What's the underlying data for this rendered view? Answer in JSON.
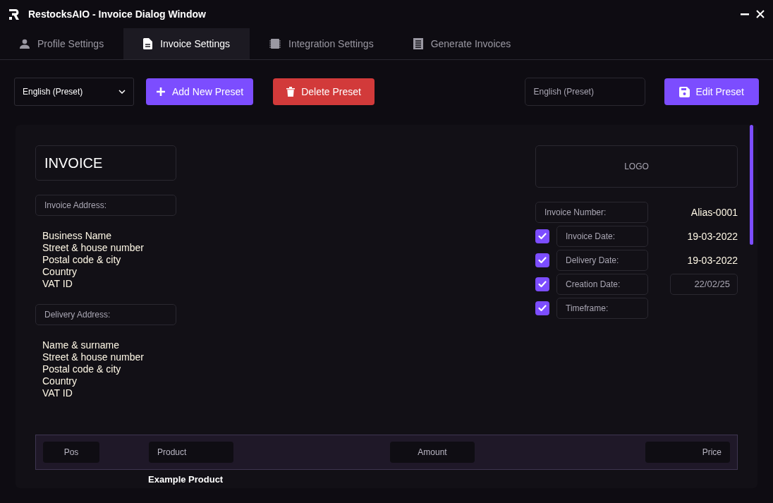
{
  "window": {
    "title": "RestocksAIO - Invoice Dialog Window"
  },
  "tabs": [
    {
      "label": "Profile Settings",
      "selected": false
    },
    {
      "label": "Invoice Settings",
      "selected": true
    },
    {
      "label": "Integration Settings",
      "selected": false
    },
    {
      "label": "Generate Invoices",
      "selected": false
    }
  ],
  "toolbar": {
    "preset_select": "English (Preset)",
    "add_button": "Add New Preset",
    "delete_button": "Delete Preset",
    "preset_name": "English (Preset)",
    "edit_button": "Edit Preset"
  },
  "invoice": {
    "title": "INVOICE",
    "logo": "LOGO",
    "invoice_address": {
      "label": "Invoice Address:",
      "lines": [
        "Business Name",
        "Street & house number",
        "Postal code & city",
        "Country",
        "VAT ID"
      ]
    },
    "delivery_address": {
      "label": "Delivery Address:",
      "lines": [
        "Name & surname",
        "Street & house number",
        "Postal code & city",
        "Country",
        "VAT ID"
      ]
    },
    "fields": [
      {
        "kind": "number",
        "label": "Invoice Number:",
        "value": "Alias-0001"
      },
      {
        "kind": "date",
        "checked": true,
        "label": "Invoice Date:",
        "value": "19-03-2022"
      },
      {
        "kind": "date",
        "checked": true,
        "label": "Delivery Date:",
        "value": "19-03-2022"
      },
      {
        "kind": "datefield",
        "checked": true,
        "label": "Creation Date:",
        "value": "22/02/25"
      },
      {
        "kind": "timeframe",
        "checked": true,
        "label": "Timeframe:"
      }
    ],
    "table": {
      "columns": [
        "Pos",
        "Product",
        "Amount",
        "Price"
      ],
      "rows": [
        {
          "product": "Example Product"
        }
      ]
    }
  }
}
